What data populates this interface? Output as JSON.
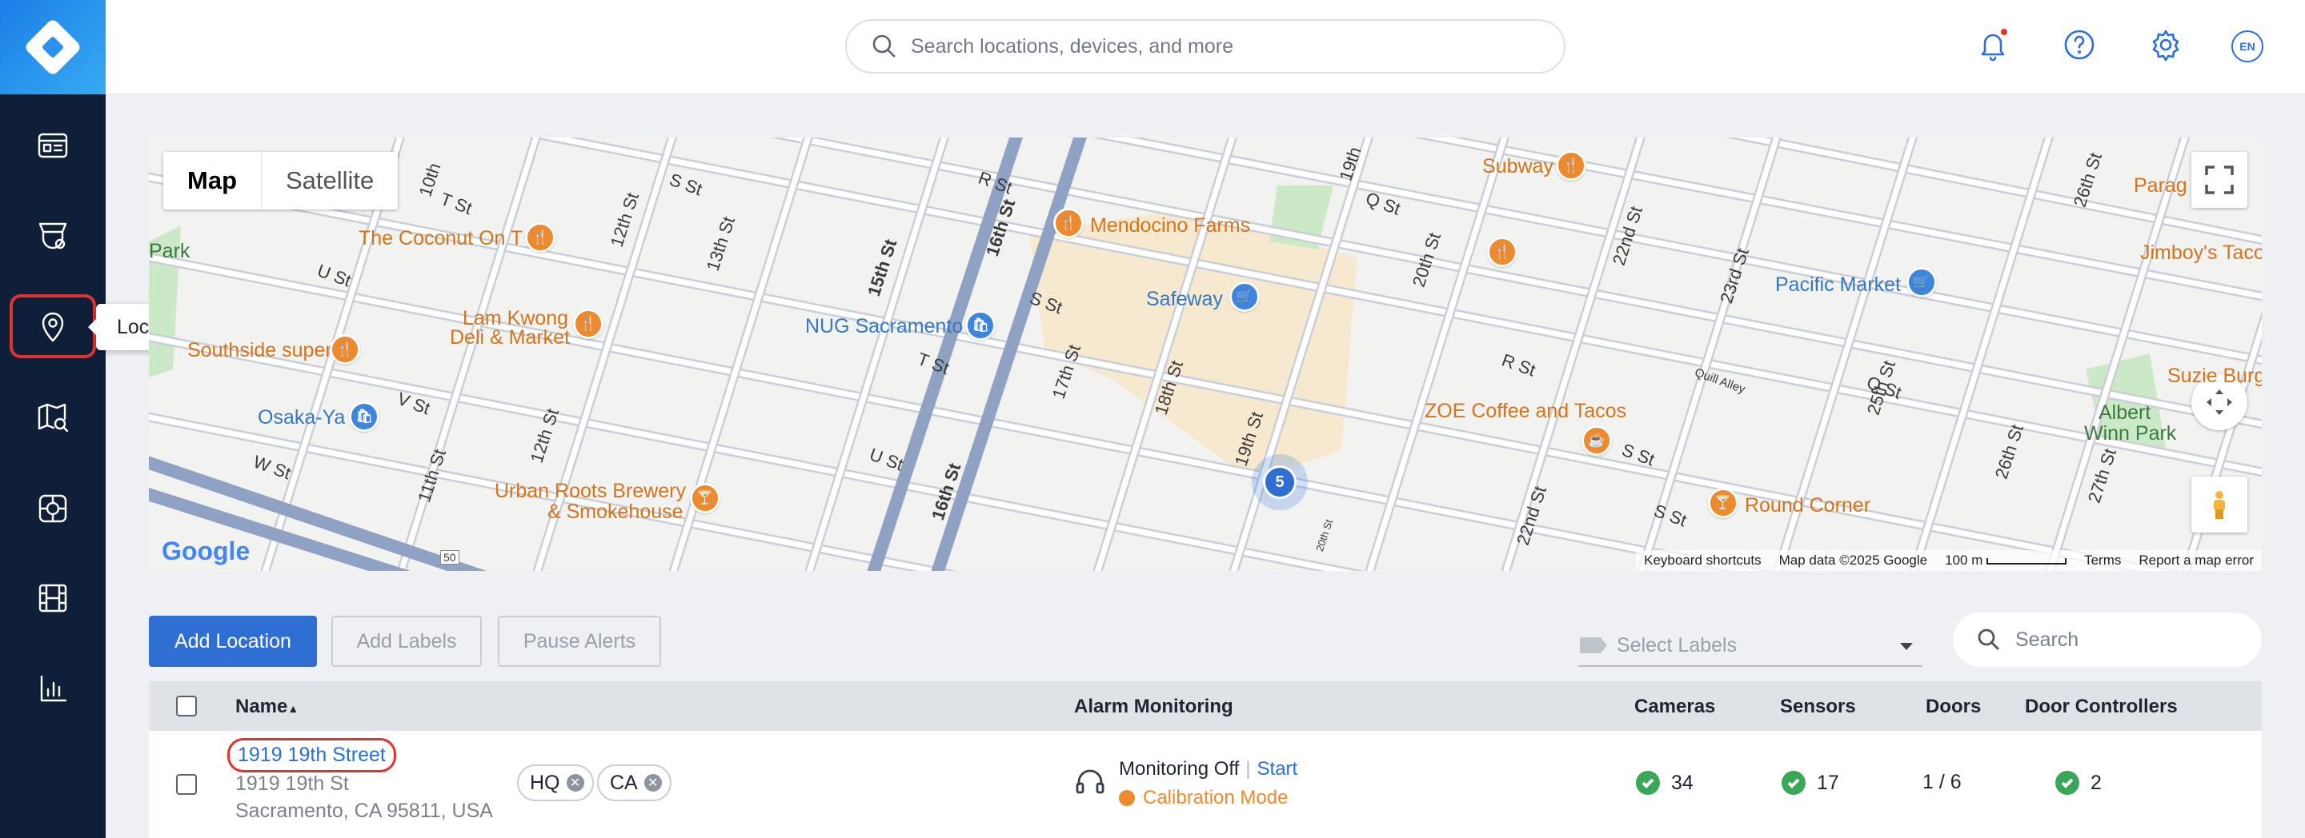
{
  "sidebar": {
    "tooltip": "Locations",
    "items": [
      {
        "icon": "dashboard-icon"
      },
      {
        "icon": "devices-icon"
      },
      {
        "icon": "location-pin-icon"
      },
      {
        "icon": "map-search-icon"
      },
      {
        "icon": "device-management-icon"
      },
      {
        "icon": "video-library-icon"
      },
      {
        "icon": "analytics-icon"
      }
    ]
  },
  "topbar": {
    "search_placeholder": "Search locations, devices, and more",
    "language": "EN"
  },
  "map": {
    "type_map": "Map",
    "type_satellite": "Satellite",
    "cluster_count": "5",
    "pois": {
      "coconut": "The Coconut On T",
      "lamkwong1": "Lam Kwong",
      "lamkwong2": "Deli & Market",
      "southside": "Southside super",
      "osaka": "Osaka-Ya",
      "urbanroots1": "Urban Roots Brewery",
      "urbanroots2": "& Smokehouse",
      "nug": "NUG Sacramento",
      "mendocino": "Mendocino Farms",
      "safeway": "Safeway",
      "subway": "Subway",
      "pacific": "Pacific Market",
      "jimboys": "Jimboy's Taco",
      "parag": "Parag",
      "zoe": "ZOE Coffee and Tacos",
      "roundcorner": "Round Corner",
      "suzie": "Suzie Burg",
      "albert1": "Albert",
      "albert2": "Winn Park",
      "park": "Park"
    },
    "streets": {
      "t": "T St",
      "u": "U St",
      "v": "V St",
      "w": "W St",
      "s": "S St",
      "r": "R St",
      "q": "Q St",
      "s10": "10th",
      "s11": "11th St",
      "s12": "12th St",
      "s13": "13th St",
      "s15": "15th St",
      "s16": "16th St",
      "s17": "17th St",
      "s18": "18th St",
      "s19": "19th St",
      "s19b": "19th",
      "s20": "20th St",
      "s22": "22nd St",
      "s23": "23rd St",
      "s25": "25th St",
      "s26": "26th St",
      "s27": "27th St",
      "quill": "Quill Alley",
      "hwy": "50",
      "s20b": "20th St"
    },
    "footer": {
      "shortcuts": "Keyboard shortcuts",
      "data": "Map data ©2025 Google",
      "scale": "100 m",
      "terms": "Terms",
      "report": "Report a map error"
    },
    "google": "Google"
  },
  "toolbar": {
    "add_location": "Add Location",
    "add_labels": "Add Labels",
    "pause_alerts": "Pause Alerts",
    "select_labels": "Select Labels",
    "search_placeholder": "Search"
  },
  "table": {
    "columns": {
      "name": "Name",
      "sort": "▲",
      "alarm": "Alarm Monitoring",
      "cameras": "Cameras",
      "sensors": "Sensors",
      "doors": "Doors",
      "controllers": "Door Controllers"
    },
    "rows": [
      {
        "name": "1919 19th Street",
        "address1": "1919 19th St",
        "address2": "Sacramento, CA 95811, USA",
        "labels": [
          "HQ",
          "CA"
        ],
        "monitoring": "Monitoring Off",
        "monitoring_sep": "|",
        "monitoring_action": "Start",
        "calibration": "Calibration Mode",
        "cameras": "34",
        "sensors": "17",
        "doors": "1 / 6",
        "controllers": "2"
      }
    ]
  },
  "colors": {
    "sidebar_bg": "#0f1f3a",
    "accent": "#2f6fd4",
    "highlight_ring": "#e0332e",
    "status_ok": "#3aa657",
    "warning": "#ee8a2e"
  }
}
